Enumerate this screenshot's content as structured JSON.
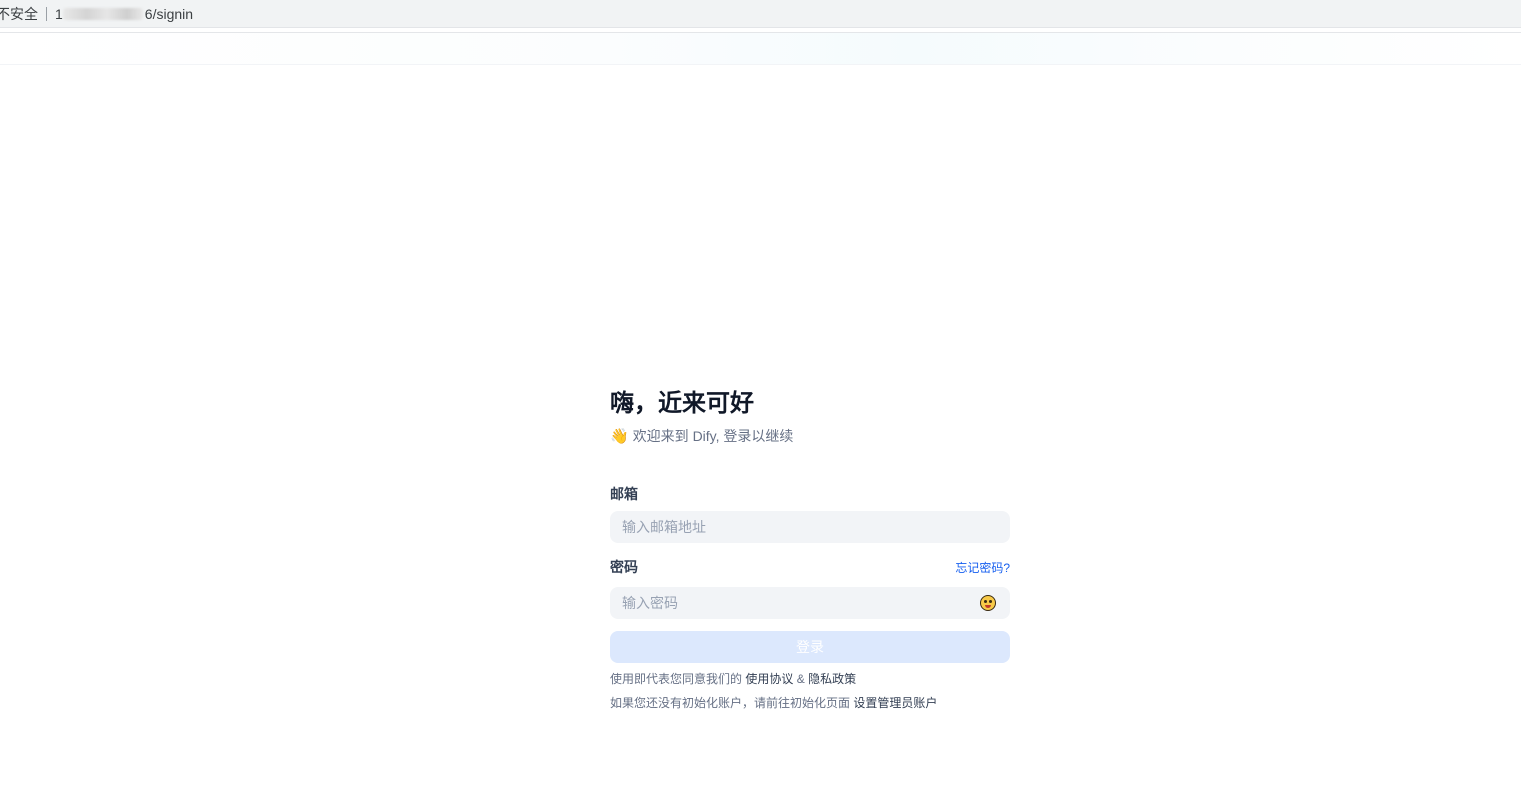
{
  "browser": {
    "security_label": "不安全",
    "url_visible_prefix": "1",
    "url_visible_suffix": "6/signin"
  },
  "signin": {
    "title": "嗨，近来可好",
    "subtitle_emoji": "👋",
    "subtitle": "欢迎来到 Dify, 登录以继续",
    "email_label": "邮箱",
    "email_placeholder": "输入邮箱地址",
    "password_label": "密码",
    "forgot_password": "忘记密码?",
    "password_placeholder": "输入密码",
    "login_button": "登录",
    "terms_prefix": "使用即代表您同意我们的",
    "terms_link": "使用协议",
    "terms_and": "&",
    "privacy_link": "隐私政策",
    "init_prefix": "如果您还没有初始化账户，请前往初始化页面",
    "init_link": "设置管理员账户"
  },
  "colors": {
    "link_blue": "#155eef",
    "button_disabled": "#dce8fd",
    "input_bg": "#f2f4f7"
  }
}
